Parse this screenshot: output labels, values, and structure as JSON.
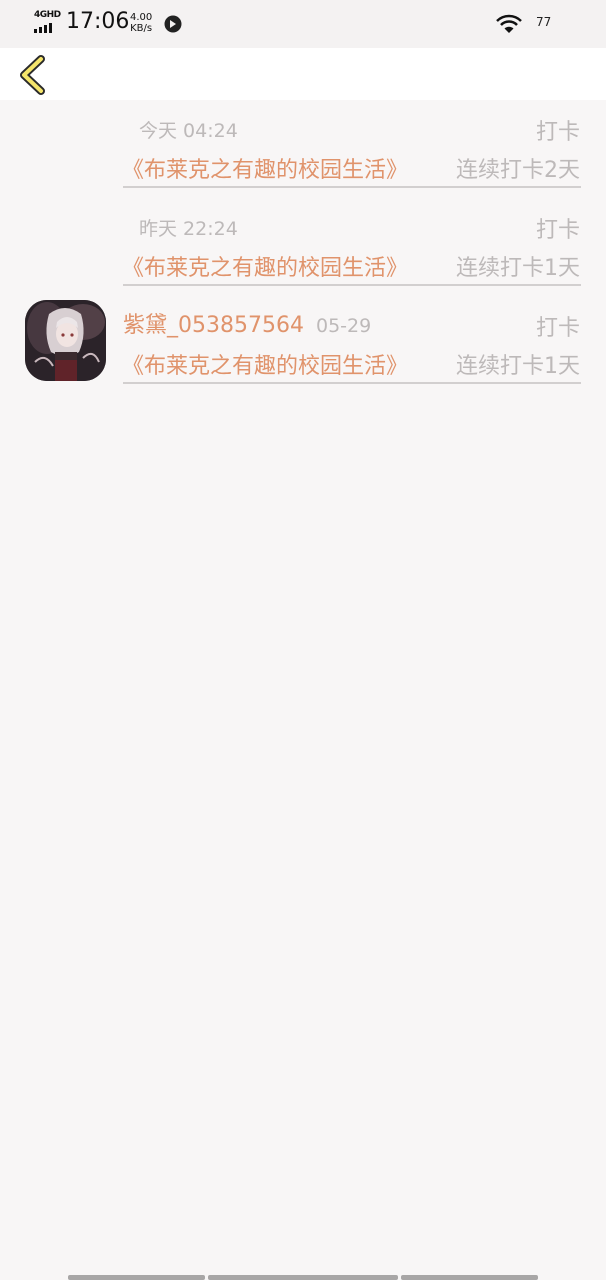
{
  "status_bar": {
    "network": "4GHD",
    "time": "17:06",
    "speed_value": "4.00",
    "speed_unit": "KB/s",
    "battery": "77"
  },
  "header": {
    "back_icon": "chevron-left-icon"
  },
  "entries": [
    {
      "time": "今天 04:24",
      "action": "打卡",
      "book": "《布莱克之有趣的校园生活》",
      "streak": "连续打卡2天"
    },
    {
      "time": "昨天 22:24",
      "action": "打卡",
      "book": "《布莱克之有趣的校园生活》",
      "streak": "连续打卡1天"
    },
    {
      "user": "紫黛_053857564",
      "time": "05-29",
      "action": "打卡",
      "book": "《布莱克之有趣的校园生活》",
      "streak": "连续打卡1天"
    }
  ],
  "colors": {
    "accent": "#e0936b",
    "muted": "#bdb9b9",
    "background": "#f8f6f6",
    "back_icon": "#f5e56b"
  }
}
